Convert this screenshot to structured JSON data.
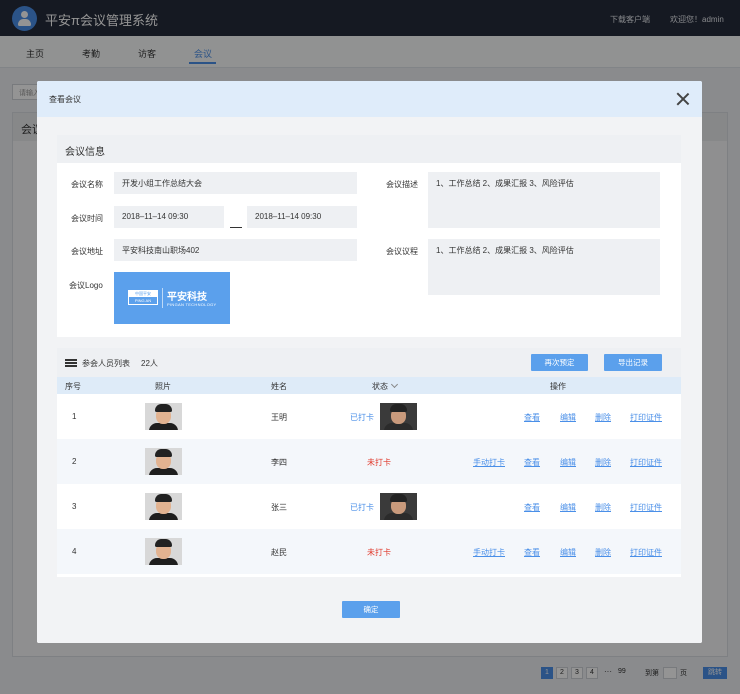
{
  "app": {
    "title": "平安π会议管理系统",
    "download_client": "下载客户端",
    "welcome": "欢迎您！admin"
  },
  "nav": {
    "tabs": [
      {
        "label": "主页"
      },
      {
        "label": "考勤"
      },
      {
        "label": "访客"
      },
      {
        "label": "会议"
      }
    ],
    "active_tab": "会议"
  },
  "background": {
    "search_placeholder": "请输入",
    "panel_title": "会议",
    "pagination": {
      "pages": [
        "1",
        "2",
        "3",
        "4"
      ],
      "active_page": "1",
      "ellipsis": "···",
      "last_page": "99",
      "goto_label": "到第",
      "page_unit": "页",
      "go_button": "跳转"
    }
  },
  "modal": {
    "title": "查看会议",
    "info_section": {
      "title": "会议信息",
      "name_label": "会议名称",
      "name_value": "开发小组工作总结大会",
      "time_label": "会议时间",
      "time_start": "2018–11–14  09:30",
      "time_end": "2018–11–14  09:30",
      "address_label": "会议地址",
      "address_value": "平安科技南山职场402",
      "logo_label": "会议Logo",
      "description_label": "会议描述",
      "description_value": "1、工作总结    2、成果汇报    3、风险评估",
      "agenda_label": "会议议程",
      "agenda_value": "1、工作总结    2、成果汇报    3、风险评估"
    },
    "logo": {
      "badge_top": "中国平安",
      "badge_bottom": "PING AN",
      "main": "平安科技",
      "sub": "PINGAN TECHNOLOGY"
    },
    "attendees": {
      "title": "参会人员列表",
      "count": "22人",
      "rebook_button": "再次预定",
      "export_button": "导出记录",
      "columns": {
        "index": "序号",
        "photo": "照片",
        "name": "姓名",
        "status": "状态",
        "actions": "操作"
      },
      "rows": [
        {
          "index": "1",
          "name": "王明",
          "status": "已打卡",
          "checked_in": true
        },
        {
          "index": "2",
          "name": "李四",
          "status": "未打卡",
          "checked_in": false,
          "manual": "手动打卡"
        },
        {
          "index": "3",
          "name": "张三",
          "status": "已打卡",
          "checked_in": true
        },
        {
          "index": "4",
          "name": "赵民",
          "status": "未打卡",
          "checked_in": false,
          "manual": "手动打卡"
        }
      ],
      "action_labels": {
        "view": "查看",
        "edit": "编辑",
        "delete": "删除",
        "print": "打印证件"
      }
    },
    "confirm_button": "确定"
  }
}
